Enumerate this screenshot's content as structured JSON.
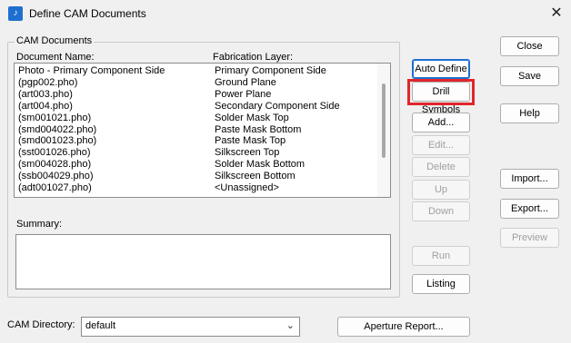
{
  "window": {
    "title": "Define CAM Documents"
  },
  "group": {
    "label": "CAM Documents"
  },
  "columns": {
    "document": "Document Name:",
    "layer": "Fabrication Layer:"
  },
  "rows": [
    {
      "doc": "Photo - Primary Component Side",
      "layer": "Primary Component Side"
    },
    {
      "doc": "(pgp002.pho)",
      "layer": "Ground Plane"
    },
    {
      "doc": "(art003.pho)",
      "layer": "Power Plane"
    },
    {
      "doc": "(art004.pho)",
      "layer": "Secondary Component Side"
    },
    {
      "doc": "(sm001021.pho)",
      "layer": "Solder Mask Top"
    },
    {
      "doc": "(smd004022.pho)",
      "layer": "Paste Mask Bottom"
    },
    {
      "doc": "(smd001023.pho)",
      "layer": "Paste Mask Top"
    },
    {
      "doc": "(sst001026.pho)",
      "layer": "Silkscreen Top"
    },
    {
      "doc": "(sm004028.pho)",
      "layer": "Solder Mask Bottom"
    },
    {
      "doc": "(ssb004029.pho)",
      "layer": "Silkscreen Bottom"
    },
    {
      "doc": "(adt001027.pho)",
      "layer": "<Unassigned>"
    }
  ],
  "summary": {
    "label": "Summary:"
  },
  "buttons": {
    "auto_define": "Auto Define",
    "drill_symbols": "Drill Symbols",
    "add": "Add...",
    "edit": "Edit...",
    "delete": "Delete",
    "up": "Up",
    "down": "Down",
    "run": "Run",
    "listing": "Listing",
    "close": "Close",
    "save": "Save",
    "help": "Help",
    "import": "Import...",
    "export": "Export...",
    "preview": "Preview",
    "aperture_report": "Aperture Report..."
  },
  "cam_directory": {
    "label": "CAM Directory:",
    "value": "default"
  },
  "colors": {
    "highlight": "#e0262c",
    "accent": "#1f6fd0"
  }
}
